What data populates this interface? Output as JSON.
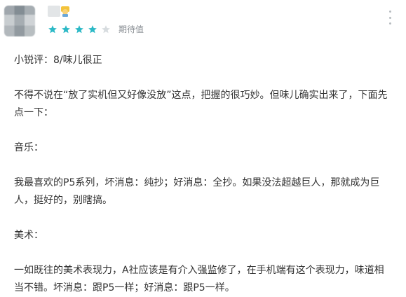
{
  "review": {
    "rating_label": "期待值",
    "stars_filled": 4,
    "stars_total": 5,
    "star_color": "#2cb9c6",
    "star_empty_color": "#d7dcdf",
    "paragraphs": [
      "小锐评：8/味儿很正",
      "不得不说在“放了实机但又好像没放”这点，把握的很巧妙。但味儿确实出来了，下面先点一下：",
      "音乐：",
      "我最喜欢的P5系列，坏消息：纯抄；好消息：全抄。如果没法超越巨人，那就成为巨人，挺好的，别瞎搞。",
      "美术：",
      "一如既往的美术表现力，A社应该是有介入强监修了，在手机端有这个表现力，味道相当不错。坏消息：跟P5一样；好消息：跟P5一样。"
    ]
  },
  "icons": {
    "avatar": "avatar-blurred",
    "badge": "user-badge-icon",
    "more": "more-vertical-icon",
    "star": "star-icon"
  }
}
